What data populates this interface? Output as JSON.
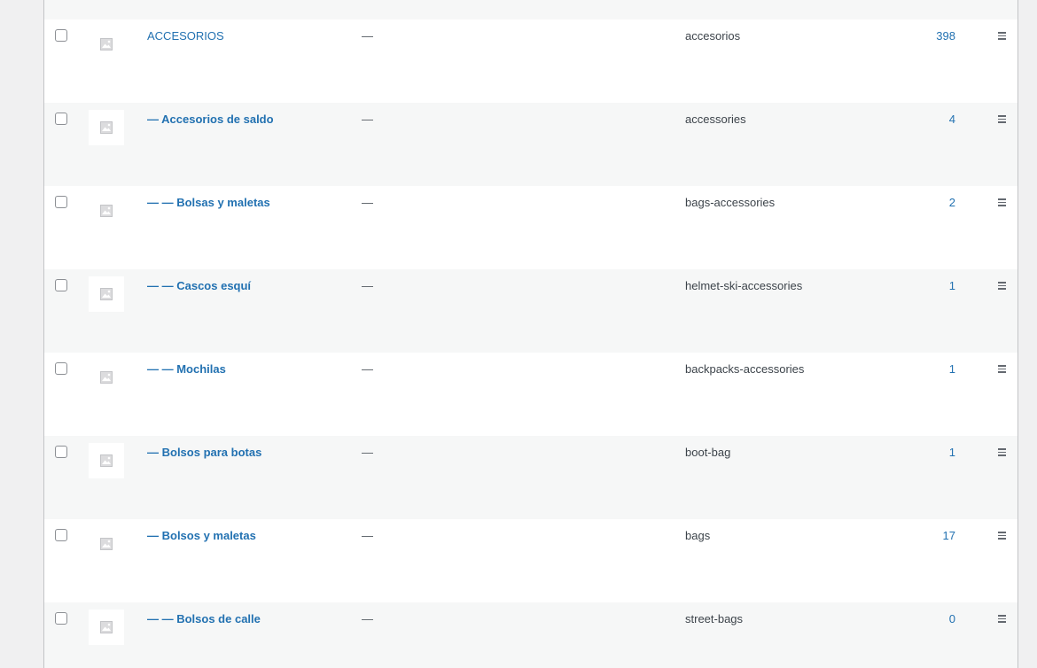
{
  "rows": [
    {
      "name": "ACCESORIOS",
      "description": "—",
      "slug": "accesorios",
      "count": "398",
      "root": true
    },
    {
      "name": "— Accesorios de saldo",
      "description": "—",
      "slug": "accessories",
      "count": "4",
      "root": false
    },
    {
      "name": "— — Bolsas y maletas",
      "description": "—",
      "slug": "bags-accessories",
      "count": "2",
      "root": false
    },
    {
      "name": "— — Cascos esquí",
      "description": "—",
      "slug": "helmet-ski-accessories",
      "count": "1",
      "root": false
    },
    {
      "name": "— — Mochilas",
      "description": "—",
      "slug": "backpacks-accessories",
      "count": "1",
      "root": false
    },
    {
      "name": "— Bolsos para botas",
      "description": "—",
      "slug": "boot-bag",
      "count": "1",
      "root": false
    },
    {
      "name": "— Bolsos y maletas",
      "description": "—",
      "slug": "bags",
      "count": "17",
      "root": false
    },
    {
      "name": "— — Bolsos de calle",
      "description": "—",
      "slug": "street-bags",
      "count": "0",
      "root": false
    }
  ],
  "icons": {
    "thumbnail": "image-placeholder-icon",
    "handle": "drag-handle-icon"
  },
  "colors": {
    "link": "#2271b1",
    "alt_row": "#f6f7f7",
    "page_bg": "#f0f0f1"
  }
}
